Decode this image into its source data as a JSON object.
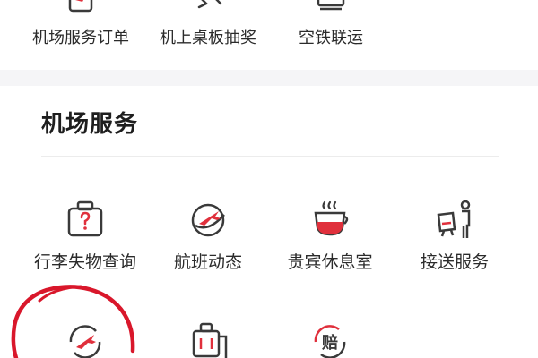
{
  "top_row": {
    "items": [
      {
        "label": "机场服务订单",
        "icon": "airport-order-icon"
      },
      {
        "label": "机上桌板抽奖",
        "icon": "tray-table-lottery-icon"
      },
      {
        "label": "空铁联运",
        "icon": "air-rail-icon"
      }
    ]
  },
  "airport_services": {
    "title": "机场服务",
    "items": [
      {
        "label": "行李失物查询",
        "icon": "lost-baggage-icon"
      },
      {
        "label": "航班动态",
        "icon": "flight-status-icon"
      },
      {
        "label": "贵宾休息室",
        "icon": "vip-lounge-icon"
      },
      {
        "label": "接送服务",
        "icon": "transfer-service-icon"
      }
    ],
    "partial_items": [
      {
        "icon": "plane-sync-icon"
      },
      {
        "icon": "luggage-cart-icon"
      },
      {
        "icon": "compensation-icon",
        "glyph": "赔"
      }
    ]
  },
  "colors": {
    "accent_red": "#e0303c",
    "icon_dark": "#3a3a3a",
    "annotation_red": "#d9172b"
  }
}
